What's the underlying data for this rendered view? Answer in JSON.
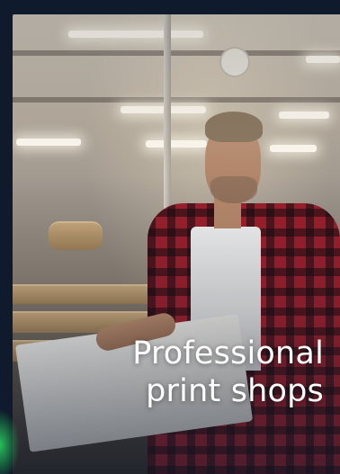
{
  "card": {
    "image_subject": "print-shop-worker-photo",
    "caption_line1": "Professional",
    "caption_line2": "print shops",
    "background_color": "#0f1a2c",
    "accent_glow_color": "#28c85a"
  }
}
